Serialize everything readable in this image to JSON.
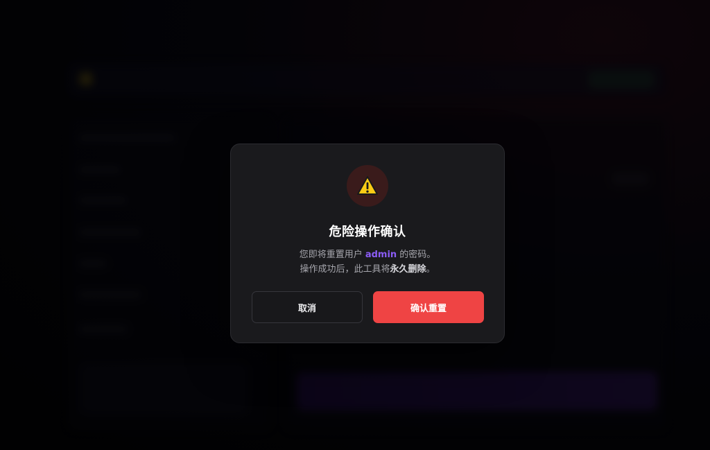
{
  "modal": {
    "icon": "warning-icon",
    "title": "危险操作确认",
    "message_prefix": "您即将重置用户 ",
    "username": "admin",
    "message_suffix": " 的密码。",
    "line2_prefix": "操作成功后，此工具将",
    "line2_emphasis": "永久删除",
    "line2_suffix": "。",
    "cancel_label": "取消",
    "confirm_label": "确认重置"
  },
  "colors": {
    "accent_danger": "#ef4444",
    "accent_user": "#8b5cf6",
    "modal_bg": "#1a1a1d",
    "warning_yellow": "#facc15"
  }
}
